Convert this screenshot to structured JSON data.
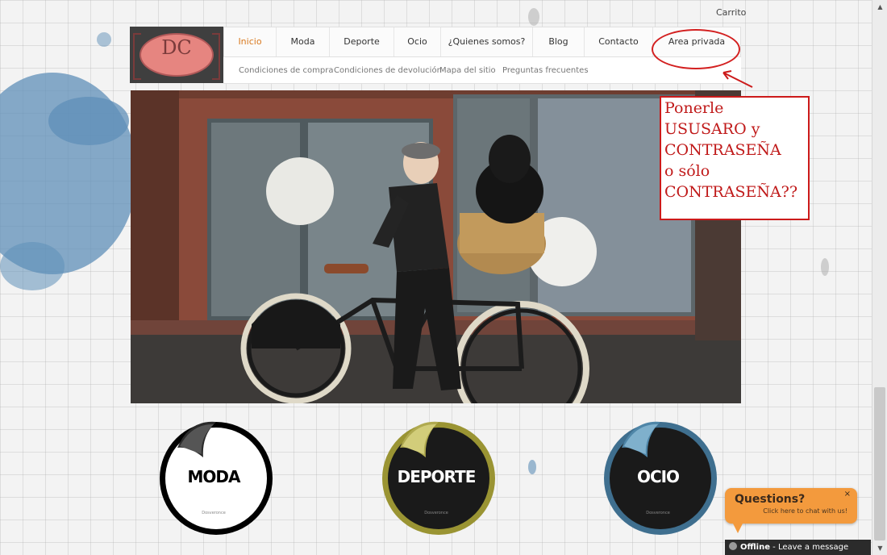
{
  "header": {
    "cart_link": "Carrito",
    "logo_text": "DC"
  },
  "nav": {
    "items": [
      {
        "label": "Inicio",
        "active": true
      },
      {
        "label": "Moda"
      },
      {
        "label": "Deporte"
      },
      {
        "label": "Ocio"
      },
      {
        "label": "¿Quienes somos?"
      },
      {
        "label": "Blog"
      },
      {
        "label": "Contacto"
      },
      {
        "label": "Area privada"
      }
    ],
    "subitems": [
      "Condiciones de compra",
      "Condiciones de devolución",
      "Mapa del sitio",
      "Preguntas frecuentes"
    ]
  },
  "annotation": {
    "lines": [
      "Ponerle",
      "USUSARO y",
      "CONTRASEÑA",
      "o sólo",
      "CONTRASEÑA??"
    ],
    "color": "#cc1a1a"
  },
  "stickers": [
    {
      "label": "MODA",
      "brand": "Dosveronce",
      "ring_color": "#000000",
      "face_color": "#ffffff",
      "text_color": "#000000"
    },
    {
      "label": "DEPORTE",
      "brand": "Dosveronce",
      "ring_color": "#9a9433",
      "face_color": "#1a1a1a",
      "text_color": "#ffffff"
    },
    {
      "label": "OCIO",
      "brand": "Dosveronce",
      "ring_color": "#3f6f8f",
      "face_color": "#1a1a1a",
      "text_color": "#ffffff"
    }
  ],
  "chat": {
    "title": "Questions?",
    "subtitle": "Click here to chat with us!",
    "close": "×",
    "offline_status": "Offline",
    "offline_message": " - Leave a message"
  },
  "colors": {
    "accent": "#d9791f",
    "annotation": "#cc1a1a",
    "chat": "#f39a3d"
  }
}
